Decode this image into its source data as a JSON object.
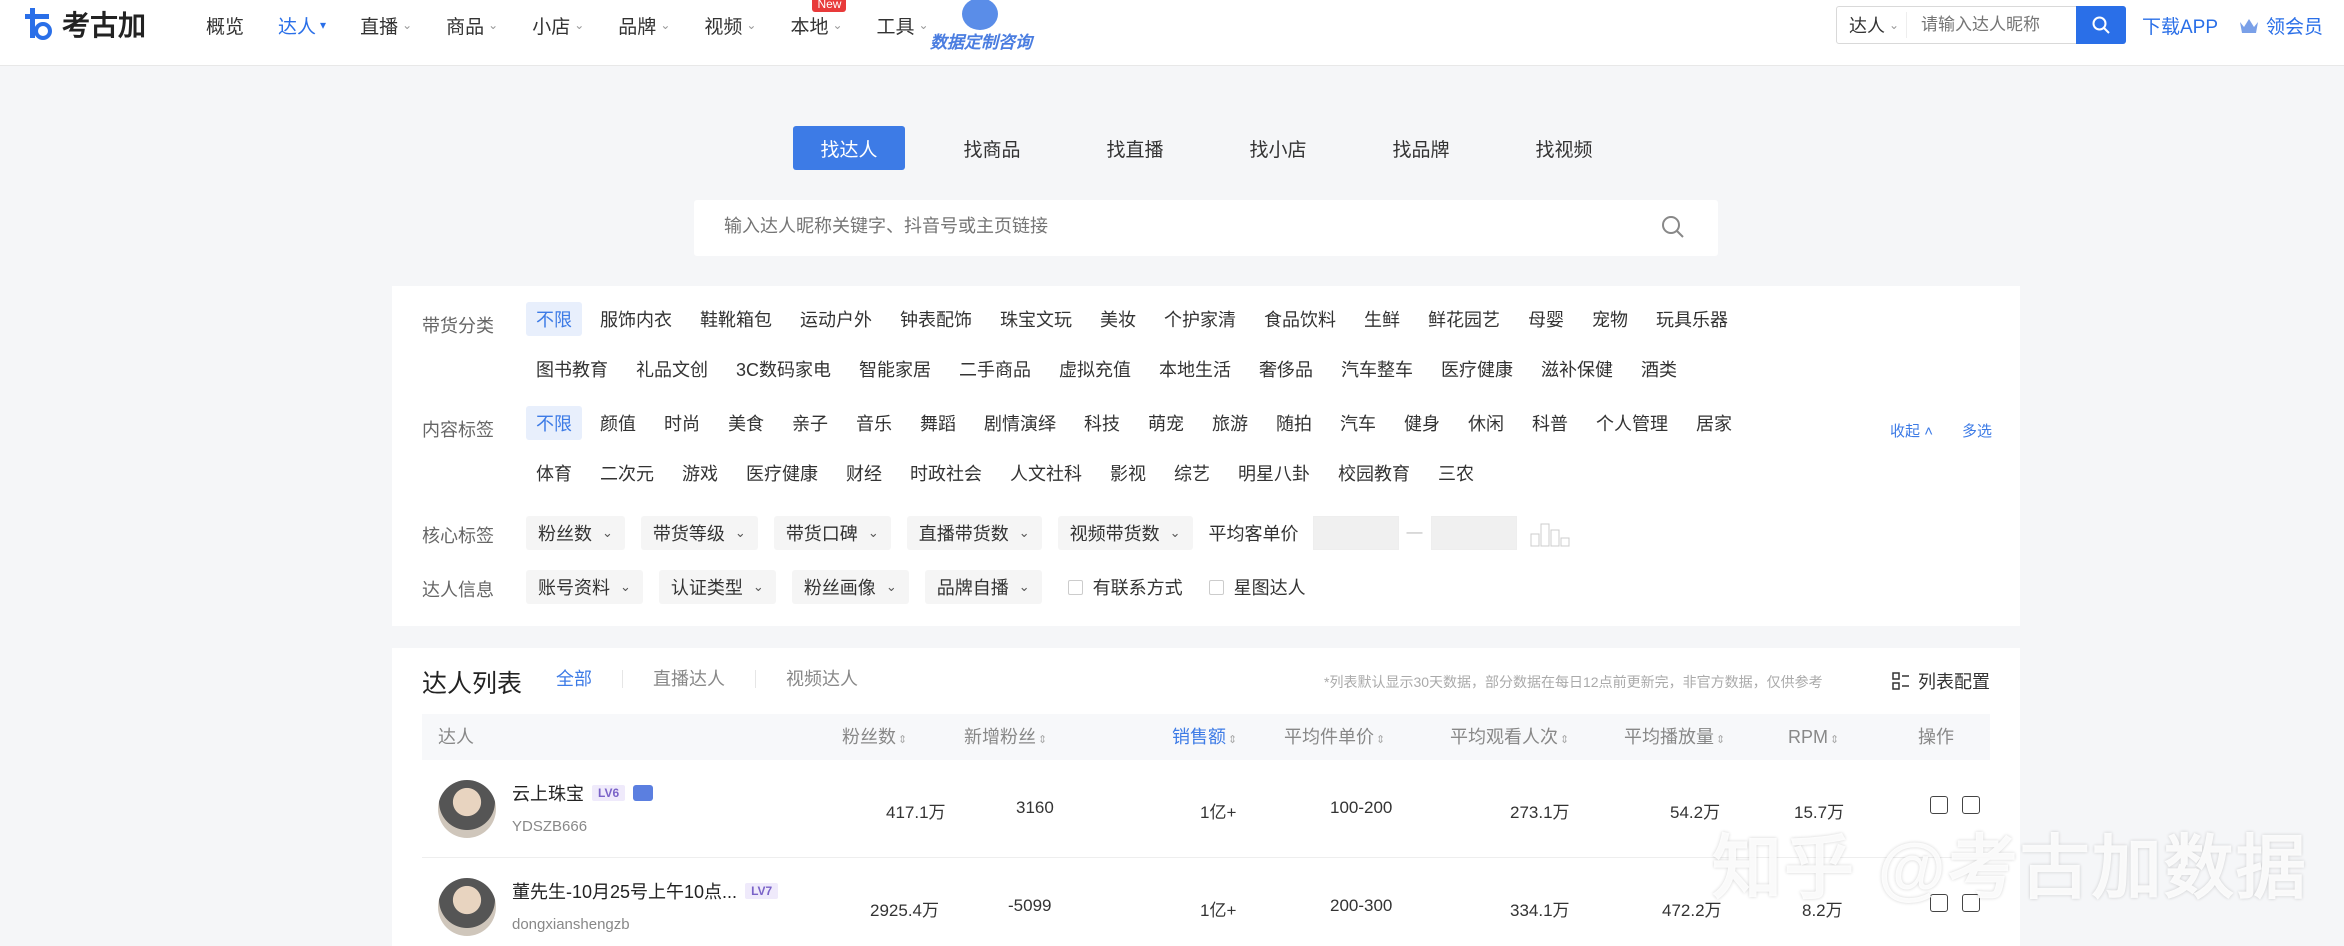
{
  "brand": {
    "logo_text": "考古加"
  },
  "nav": {
    "items": [
      {
        "label": "概览",
        "has_caret": false
      },
      {
        "label": "达人",
        "has_caret": true,
        "active": true
      },
      {
        "label": "直播",
        "has_caret": true
      },
      {
        "label": "商品",
        "has_caret": true
      },
      {
        "label": "小店",
        "has_caret": true
      },
      {
        "label": "品牌",
        "has_caret": true
      },
      {
        "label": "视频",
        "has_caret": true
      },
      {
        "label": "本地",
        "has_caret": true,
        "badge": "New"
      },
      {
        "label": "工具",
        "has_caret": true
      }
    ],
    "promo_text": "数据定制咨询",
    "search_type": "达人",
    "search_placeholder": "请输入达人昵称",
    "download_label": "下载APP",
    "member_label": "领会员"
  },
  "main_tabs": [
    "找达人",
    "找商品",
    "找直播",
    "找小店",
    "找品牌",
    "找视频"
  ],
  "main_search": {
    "placeholder": "输入达人昵称关键字、抖音号或主页链接"
  },
  "filters": {
    "category": {
      "label": "带货分类",
      "row1": [
        "不限",
        "服饰内衣",
        "鞋靴箱包",
        "运动户外",
        "钟表配饰",
        "珠宝文玩",
        "美妆",
        "个护家清",
        "食品饮料",
        "生鲜",
        "鲜花园艺",
        "母婴",
        "宠物",
        "玩具乐器"
      ],
      "row2": [
        "图书教育",
        "礼品文创",
        "3C数码家电",
        "智能家居",
        "二手商品",
        "虚拟充值",
        "本地生活",
        "奢侈品",
        "汽车整车",
        "医疗健康",
        "滋补保健",
        "酒类"
      ]
    },
    "content": {
      "label": "内容标签",
      "row1": [
        "不限",
        "颜值",
        "时尚",
        "美食",
        "亲子",
        "音乐",
        "舞蹈",
        "剧情演绎",
        "科技",
        "萌宠",
        "旅游",
        "随拍",
        "汽车",
        "健身",
        "休闲",
        "科普",
        "个人管理",
        "居家"
      ],
      "row2": [
        "体育",
        "二次元",
        "游戏",
        "医疗健康",
        "财经",
        "时政社会",
        "人文社科",
        "影视",
        "综艺",
        "明星八卦",
        "校园教育",
        "三农"
      ],
      "collapse_label": "收起",
      "multi_label": "多选"
    },
    "core": {
      "label": "核心标签",
      "dropdowns": [
        "粉丝数",
        "带货等级",
        "带货口碑",
        "直播带货数",
        "视频带货数"
      ],
      "price_label": "平均客单价",
      "range_sep": "—"
    },
    "info": {
      "label": "达人信息",
      "dropdowns": [
        "账号资料",
        "认证类型",
        "粉丝画像",
        "品牌自播"
      ],
      "checkboxes": [
        "有联系方式",
        "星图达人"
      ]
    }
  },
  "list": {
    "title": "达人列表",
    "tabs": [
      "全部",
      "直播达人",
      "视频达人"
    ],
    "note": "*列表默认显示30天数据，部分数据在每日12点前更新完，非官方数据，仅供参考",
    "config_label": "列表配置",
    "columns": [
      "达人",
      "粉丝数",
      "新增粉丝",
      "销售额",
      "平均件单价",
      "平均观看人次",
      "平均播放量",
      "RPM",
      "操作"
    ],
    "rows": [
      {
        "name": "云上珠宝",
        "level": "LV6",
        "verified": true,
        "id": "YDSZB666",
        "fans": "417.1万",
        "new_fans": "3160",
        "sales": "1亿+",
        "unit_price": "100-200",
        "avg_viewers": "273.1万",
        "avg_plays": "54.2万",
        "rpm": "15.7万"
      },
      {
        "name": "董先生-10月25号上午10点...",
        "level": "LV7",
        "verified": false,
        "id": "dongxianshengzb",
        "fans": "2925.4万",
        "new_fans": "-5099",
        "sales": "1亿+",
        "unit_price": "200-300",
        "avg_viewers": "334.1万",
        "avg_plays": "472.2万",
        "rpm": "8.2万"
      }
    ]
  },
  "watermark": "知乎 @考古加数据",
  "colors": {
    "accent": "#3d7be6",
    "new_badge": "#e83a3a",
    "level_badge": "#7a63c8"
  }
}
